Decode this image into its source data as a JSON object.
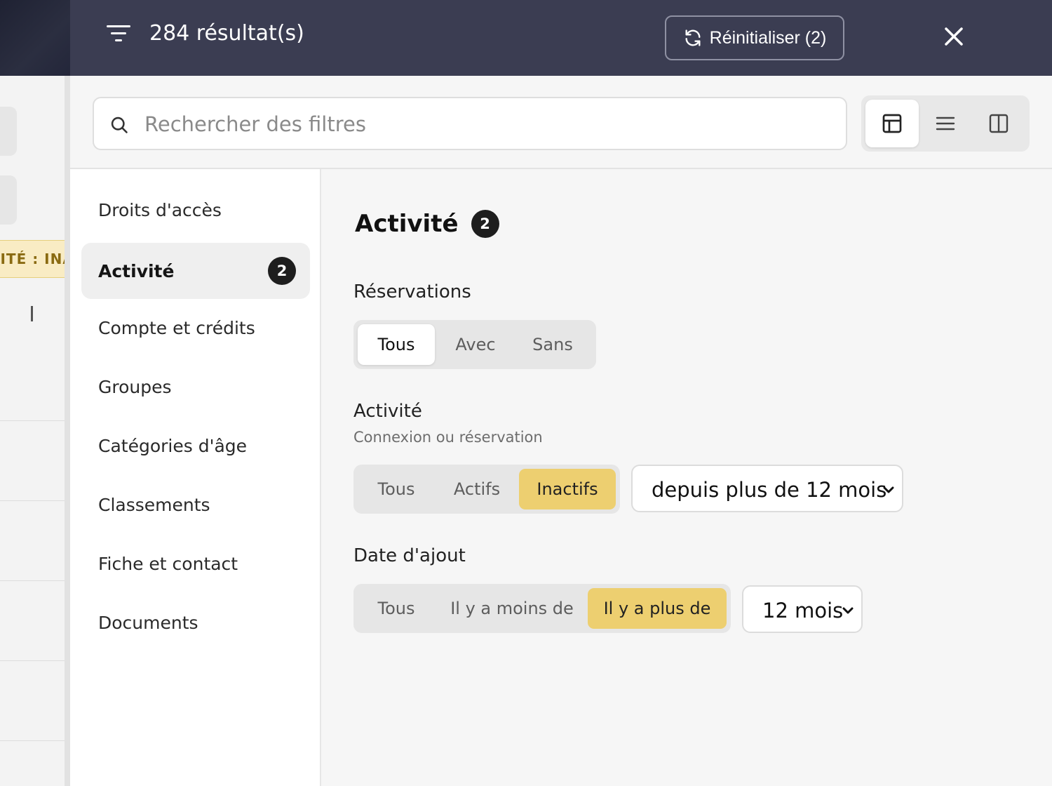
{
  "background": {
    "badge_text": "VITÉ : INA",
    "badge_color": "#f9ecc4"
  },
  "header": {
    "results_label": "284 résultat(s)",
    "reset_label": "Réinitialiser (2)",
    "background_color": "#3b3d52"
  },
  "search": {
    "placeholder": "Rechercher des filtres",
    "value": ""
  },
  "view_modes": [
    "layout-icon",
    "list-icon",
    "columns-icon"
  ],
  "sidebar": {
    "items": [
      {
        "label": "Droits d'accès",
        "count": ""
      },
      {
        "label": "Activité",
        "count": "2"
      },
      {
        "label": "Compte et crédits",
        "count": ""
      },
      {
        "label": "Groupes",
        "count": ""
      },
      {
        "label": "Catégories d'âge",
        "count": ""
      },
      {
        "label": "Classements",
        "count": ""
      },
      {
        "label": "Fiche et contact",
        "count": ""
      },
      {
        "label": "Documents",
        "count": ""
      }
    ]
  },
  "main": {
    "title": "Activité",
    "title_count": "2",
    "reservations": {
      "label": "Réservations",
      "options": [
        "Tous",
        "Avec",
        "Sans"
      ],
      "selected": "Tous"
    },
    "activity": {
      "label": "Activité",
      "sublabel": "Connexion ou réservation",
      "options": [
        "Tous",
        "Actifs",
        "Inactifs"
      ],
      "selected": "Inactifs",
      "period_value": "depuis plus de 12 mois"
    },
    "date_added": {
      "label": "Date d'ajout",
      "options": [
        "Tous",
        "Il y a moins de",
        "Il y a plus de"
      ],
      "selected": "Il y a plus de",
      "period_value": "12 mois"
    },
    "accent_color": "#edcf70"
  }
}
